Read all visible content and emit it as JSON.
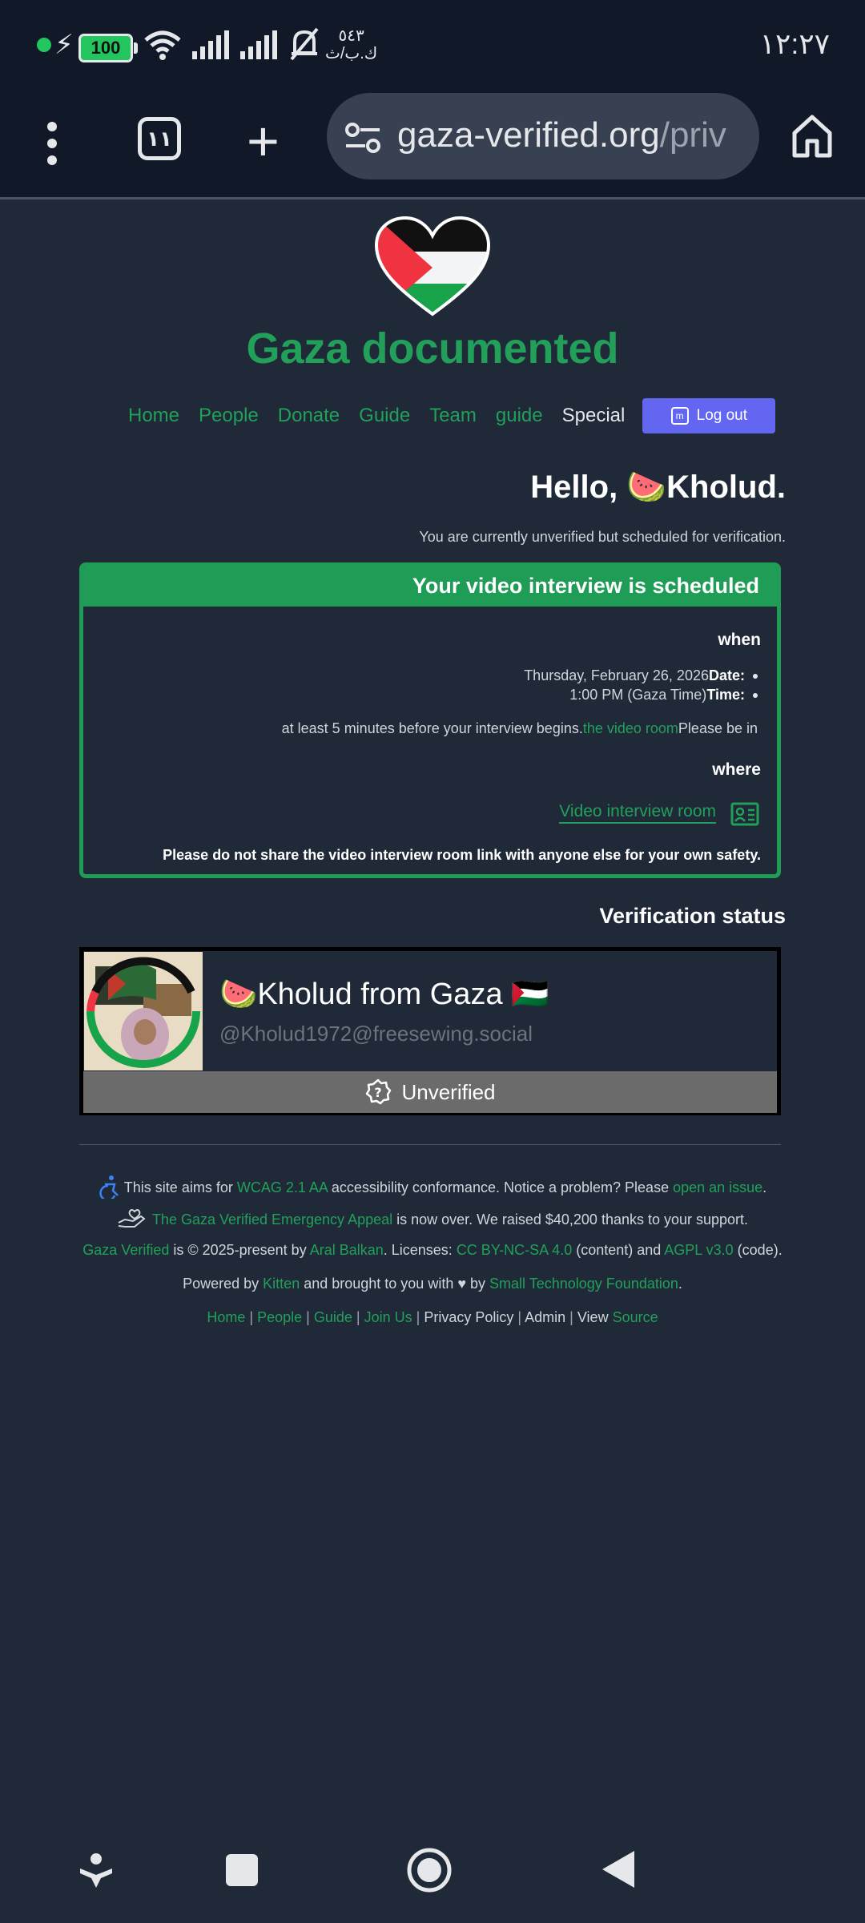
{
  "status_bar": {
    "battery": "100",
    "speed_value": "٥٤٣",
    "speed_unit": "ك.ب/ث",
    "time": "١٢:٢٧"
  },
  "browser": {
    "tab_count": "١١",
    "url_main": "gaza-verified.org",
    "url_rest": "/priv"
  },
  "site": {
    "title": "Gaza documented",
    "nav": [
      "Home",
      "People",
      "Donate",
      "Guide",
      "Team",
      "guide",
      "Special"
    ],
    "logout_label": "Log out"
  },
  "greeting": {
    "hello_prefix": "Hello, ",
    "emoji": "🍉",
    "name": "Kholud.",
    "subtitle": "You are currently unverified but scheduled for verification."
  },
  "interview": {
    "heading": "Your video interview is scheduled",
    "when_label": "when",
    "date_value": "Thursday, February 26, 2026",
    "date_label": "Date:",
    "time_value": "1:00 PM (Gaza Time)",
    "time_label": "Time:",
    "be_in_a": "at least 5 minutes before your interview begins.",
    "be_in_link": "the video room",
    "be_in_b": "Please be in",
    "where_label": "where",
    "room_link": "Video interview room",
    "warning": "Please do not share the video interview room link with anyone else for your own safety."
  },
  "verification": {
    "title": "Verification status",
    "display_name": "🍉Kholud from Gaza 🇵🇸",
    "handle": "@Kholud1972@freesewing.social",
    "status": "Unverified"
  },
  "footer": {
    "a11y_a": "This site aims for ",
    "a11y_link": "WCAG 2.1 AA",
    "a11y_b": " accessibility conformance. Notice a problem? Please ",
    "a11y_link2": "open an issue",
    "a11y_c": ".",
    "appeal_link": "The Gaza Verified Emergency Appeal",
    "appeal_text": " is now over. We raised $40,200 thanks to your support.",
    "copy_link1": "Gaza Verified",
    "copy_a": " is © 2025-present by ",
    "copy_link2": "Aral Balkan",
    "copy_b": ". Licenses: ",
    "copy_link3": "CC BY-NC-SA 4.0",
    "copy_c": " (content) and ",
    "copy_link4": "AGPL v3.0",
    "copy_d": " (code).",
    "powered_a": "Powered by ",
    "powered_link1": "Kitten",
    "powered_b": " and brought to you with ♥ by ",
    "powered_link2": "Small Technology Foundation",
    "powered_c": ".",
    "links": {
      "home": "Home",
      "people": "People",
      "guide": "Guide",
      "join": "Join Us",
      "privacy": "Privacy Policy",
      "admin": "Admin",
      "view": "View",
      "source": "Source"
    }
  },
  "colors": {
    "accent": "#22a05a",
    "button": "#6366f1",
    "page_bg": "#1f2937"
  }
}
